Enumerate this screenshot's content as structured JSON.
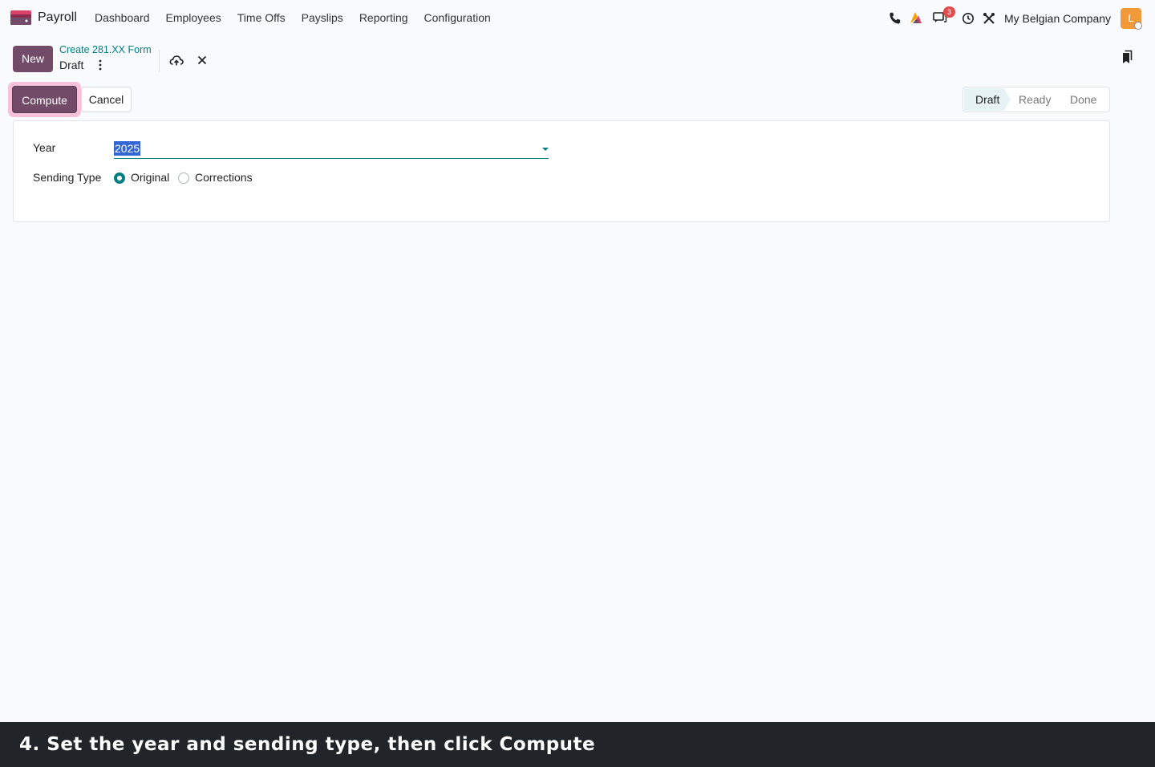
{
  "navbar": {
    "app_name": "Payroll",
    "menu": [
      "Dashboard",
      "Employees",
      "Time Offs",
      "Payslips",
      "Reporting",
      "Configuration"
    ],
    "messages_badge": "3",
    "company": "My Belgian Company",
    "avatar_letter": "L",
    "icons": [
      "phone-icon",
      "activity-icon",
      "messages-icon",
      "clock-icon",
      "tools-icon"
    ]
  },
  "control_panel": {
    "new_label": "New",
    "breadcrumb_parent": "Create 281.XX Form",
    "breadcrumb_current": "Draft"
  },
  "buttons": {
    "compute": "Compute",
    "cancel": "Cancel"
  },
  "statusbar": {
    "stages": [
      "Draft",
      "Ready",
      "Done"
    ],
    "active": "Draft"
  },
  "form": {
    "year_label": "Year",
    "year_value": "2025",
    "sending_type_label": "Sending Type",
    "sending_options": [
      "Original",
      "Corrections"
    ],
    "sending_selected": "Original"
  },
  "caption": "4. Set the year and sending type, then click Compute",
  "colors": {
    "brand": "#714b67",
    "accent": "#017e84",
    "highlight_ring": "#f7c1d9"
  }
}
